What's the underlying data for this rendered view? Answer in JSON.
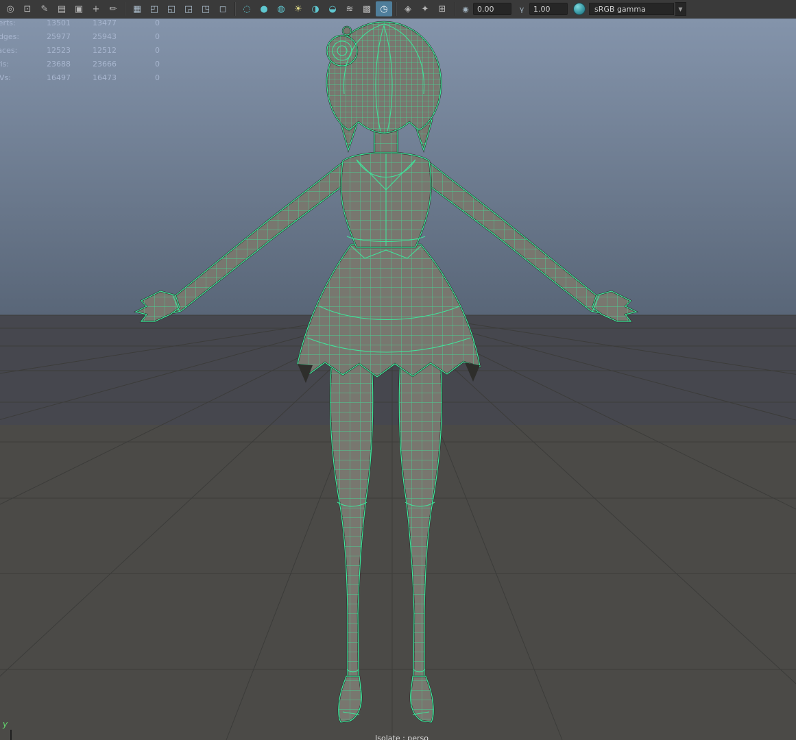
{
  "toolbar": {
    "icons": [
      {
        "name": "select-camera-icon",
        "glyph": "◎"
      },
      {
        "name": "lock-camera-icon",
        "glyph": "⊡"
      },
      {
        "name": "camera-attributes-icon",
        "glyph": "✎"
      },
      {
        "name": "bookmarks-icon",
        "glyph": "▤"
      },
      {
        "name": "image-plane-icon",
        "glyph": "▣"
      },
      {
        "name": "pan-zoom-icon",
        "glyph": "+"
      },
      {
        "name": "grease-pencil-icon",
        "glyph": "✏"
      },
      {
        "name": "grid-display-icon",
        "glyph": "▦"
      },
      {
        "name": "film-gate-icon",
        "glyph": "◰"
      },
      {
        "name": "resolution-gate-icon",
        "glyph": "◱"
      },
      {
        "name": "gate-mask-icon",
        "glyph": "◲"
      },
      {
        "name": "field-chart-icon",
        "glyph": "◳"
      },
      {
        "name": "safe-action-icon",
        "glyph": "◻"
      },
      {
        "name": "wireframe-display-icon",
        "glyph": "◌"
      },
      {
        "name": "smooth-shade-icon",
        "glyph": "●"
      },
      {
        "name": "textured-display-icon",
        "glyph": "◍"
      },
      {
        "name": "use-all-lights-icon",
        "glyph": "☀"
      },
      {
        "name": "shadows-icon",
        "glyph": "◑"
      },
      {
        "name": "screen-space-ao-icon",
        "glyph": "◒"
      },
      {
        "name": "motion-blur-icon",
        "glyph": "≋"
      },
      {
        "name": "multisample-icon",
        "glyph": "▩"
      },
      {
        "name": "sequence-time-icon",
        "glyph": "◷"
      },
      {
        "name": "xray-display-icon",
        "glyph": "◈"
      },
      {
        "name": "backface-culling-icon",
        "glyph": "✦"
      },
      {
        "name": "viewport-settings-icon",
        "glyph": "⊞"
      }
    ],
    "exposure": {
      "icon": "◉",
      "value": "0.00"
    },
    "gamma": {
      "icon": "γ",
      "value": "1.00"
    },
    "view_transform": {
      "value": "sRGB gamma",
      "arrow": "▼"
    }
  },
  "hud": {
    "rows": [
      {
        "label": "Verts:",
        "v1": "13501",
        "v2": "13477",
        "v3": "0"
      },
      {
        "label": "Edges:",
        "v1": "25977",
        "v2": "25943",
        "v3": "0"
      },
      {
        "label": "Faces:",
        "v1": "12523",
        "v2": "12512",
        "v3": "0"
      },
      {
        "label": "Tris:",
        "v1": "23688",
        "v2": "23666",
        "v3": "0"
      },
      {
        "label": "UVs:",
        "v1": "16497",
        "v2": "16473",
        "v3": "0"
      }
    ]
  },
  "viewport": {
    "isolate_label": "Isolate : perso",
    "axis_y_label": "y"
  },
  "colors": {
    "wireframe_green": "#3fe79c",
    "body_gray": "#78776f",
    "toolbar_bg": "#3a3a3a",
    "hud_text": "#a8b6cf",
    "selected_icon_bg": "#4f7e9b",
    "sky_top": "#8494ab",
    "sky_bottom": "#596678",
    "ground_far": "#46474e",
    "ground_near": "#4b4a47",
    "grid_line": "#3c3c3a"
  }
}
